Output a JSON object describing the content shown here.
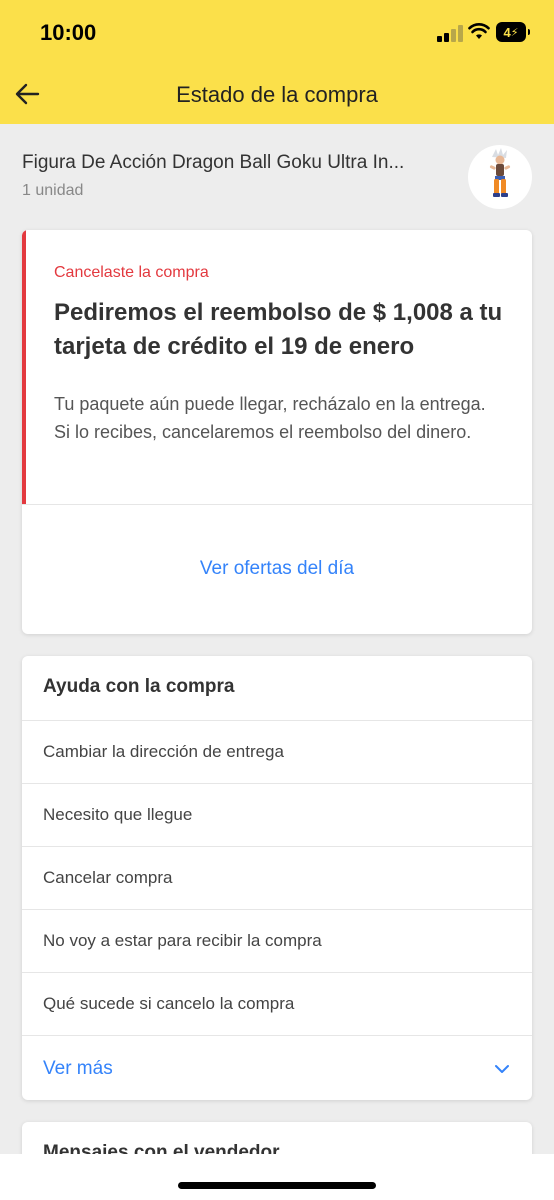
{
  "status_bar": {
    "time": "10:00",
    "battery": "4"
  },
  "nav": {
    "title": "Estado de la compra",
    "back_icon": "arrow-left-icon"
  },
  "product": {
    "name": "Figura De Acción Dragon Ball Goku Ultra In...",
    "quantity": "1 unidad"
  },
  "status": {
    "eyebrow": "Cancelaste la compra",
    "headline": "Pediremos el reembolso de $ 1,008 a tu tarjeta de crédito el 19 de enero",
    "body": "Tu paquete aún puede llegar, recházalo en la entrega. Si lo recibes, cancelaremos el reembolso del dinero.",
    "action": "Ver ofertas del día",
    "accent_color": "#e3393f"
  },
  "help": {
    "title": "Ayuda con la compra",
    "items": [
      {
        "label": "Cambiar la dirección de entrega"
      },
      {
        "label": "Necesito que llegue"
      },
      {
        "label": "Cancelar compra"
      },
      {
        "label": "No voy a estar para recibir la compra"
      },
      {
        "label": "Qué sucede si cancelo la compra"
      }
    ],
    "see_more": "Ver más"
  },
  "seller": {
    "title": "Mensajes con el vendedor"
  },
  "colors": {
    "brand_yellow": "#fbe04a",
    "link_blue": "#3483fa"
  }
}
